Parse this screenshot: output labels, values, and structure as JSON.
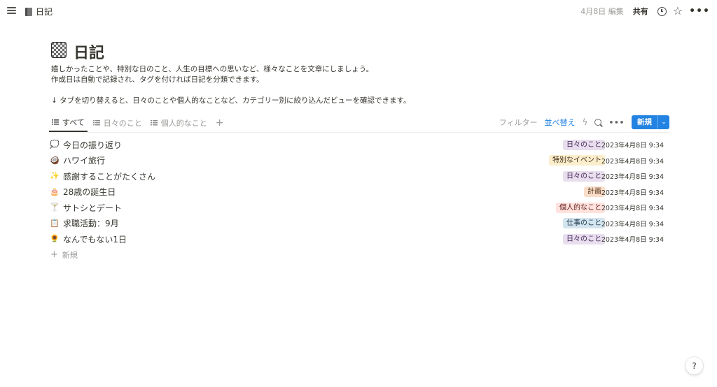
{
  "topbar": {
    "breadcrumb": "日記",
    "edited": "4月8日 編集",
    "share": "共有",
    "icons": [
      "menu-icon",
      "book-icon",
      "clock-icon",
      "star-icon",
      "more-icon"
    ]
  },
  "page": {
    "title": "日記",
    "icon": "checkered-notebook-icon",
    "description": [
      "嬉しかったことや、特別な日のこと、人生の目標への思いなど、様々なことを文章にしましょう。",
      "作成日は自動で記録され、タグを付ければ日記を分類できます。",
      "↓ タブを切り替えると、日々のことや個人的なことなど、カテゴリー別に絞り込んだビューを確認できます。"
    ]
  },
  "tabs": [
    {
      "label": "すべて",
      "active": true
    },
    {
      "label": "日々のこと",
      "active": false
    },
    {
      "label": "個人的なこと",
      "active": false
    }
  ],
  "toolbar": {
    "filter": "フィルター",
    "sort": "並べ替え",
    "new": "新規"
  },
  "rows": [
    {
      "emoji": "💭",
      "title": "今日の振り返り",
      "tag": "日々のこと",
      "tag_color": "#e8deee",
      "date": "2023年4月8日 9:34"
    },
    {
      "emoji": "🥥",
      "title": "ハワイ旅行",
      "tag": "特別なイベント",
      "tag_color": "#fbeecc",
      "date": "2023年4月8日 9:34"
    },
    {
      "emoji": "✨",
      "title": "感謝することがたくさん",
      "tag": "日々のこと",
      "tag_color": "#e8deee",
      "date": "2023年4月8日 9:34"
    },
    {
      "emoji": "🎂",
      "title": "28歳の誕生日",
      "tag": "計画",
      "tag_color": "#fadec9",
      "date": "2023年4月8日 9:34"
    },
    {
      "emoji": "🍸",
      "title": "サトシとデート",
      "tag": "個人的なこと",
      "tag_color": "#ffe2dd",
      "date": "2023年4月8日 9:34"
    },
    {
      "emoji": "📋",
      "title": "求職活動：9月",
      "tag": "仕事のこと",
      "tag_color": "#d3e5ef",
      "date": "2023年4月8日 9:34"
    },
    {
      "emoji": "🌻",
      "title": "なんでもない1日",
      "tag": "日々のこと",
      "tag_color": "#e8deee",
      "date": "2023年4月8日 9:34"
    }
  ],
  "add_new": "新規",
  "help": "?"
}
